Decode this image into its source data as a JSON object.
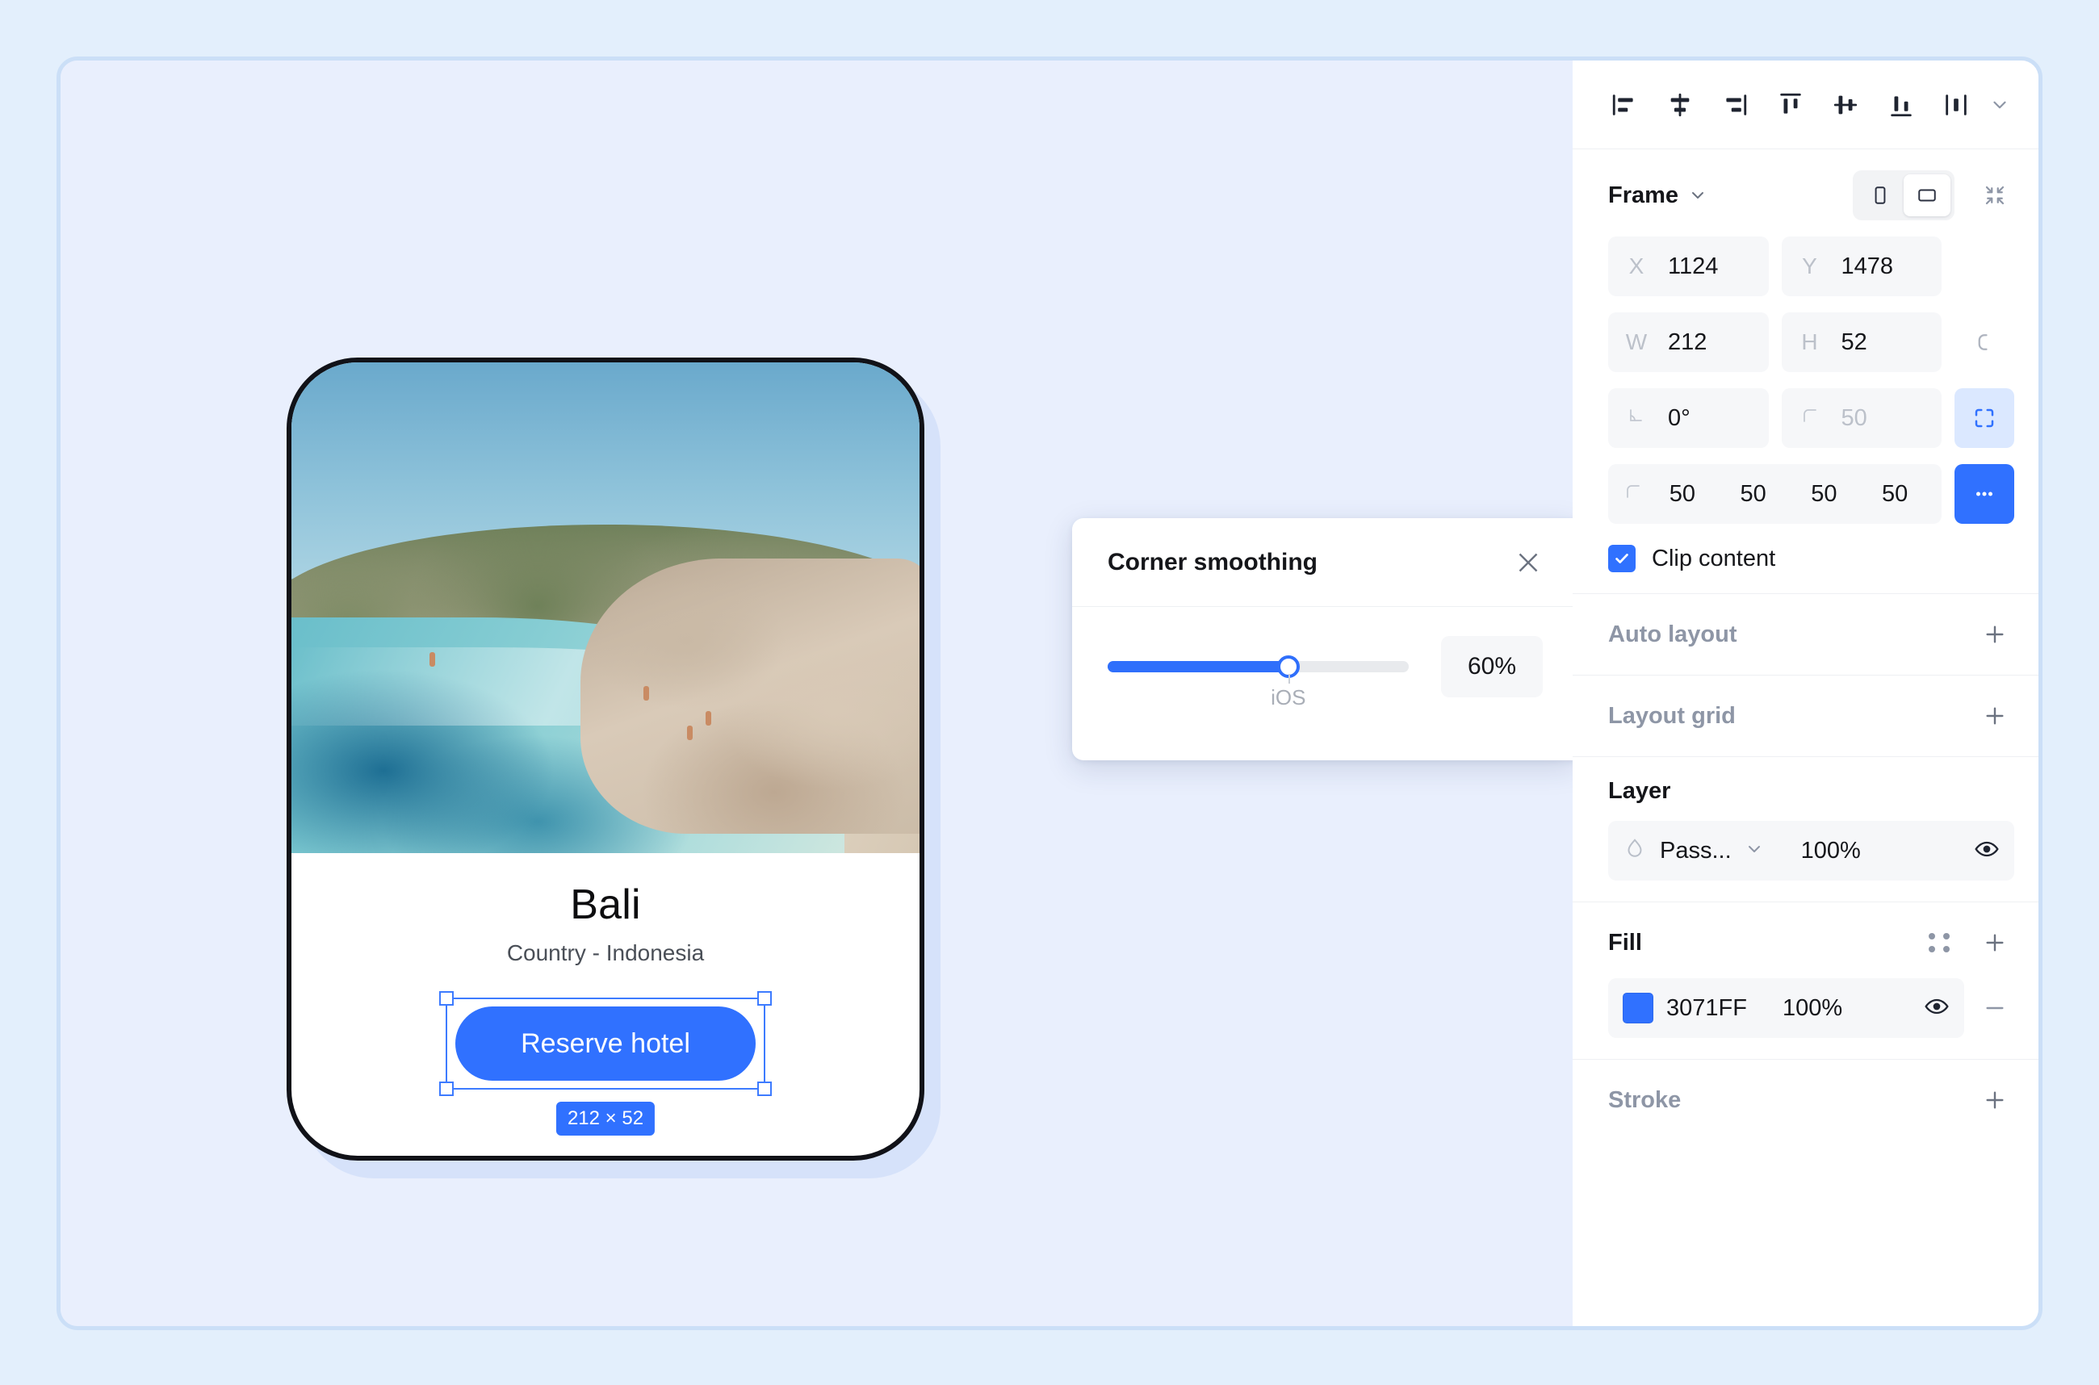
{
  "canvas": {
    "card": {
      "title": "Bali",
      "subtitle": "Country - Indonesia",
      "button_label": "Reserve hotel",
      "size_badge": "212 × 52"
    }
  },
  "dialog": {
    "title": "Corner smoothing",
    "close_icon": "close-icon",
    "slider": {
      "value_percent": 60,
      "tick_label": "iOS",
      "tick_position_percent": 60
    },
    "value_label": "60%"
  },
  "panel": {
    "align_tools": [
      {
        "name": "align-left",
        "label": "Align left"
      },
      {
        "name": "align-horizontal-center",
        "label": "Align horizontal centers"
      },
      {
        "name": "align-right",
        "label": "Align right"
      },
      {
        "name": "align-top",
        "label": "Align top"
      },
      {
        "name": "align-vertical-center",
        "label": "Align vertical centers"
      },
      {
        "name": "align-bottom",
        "label": "Align bottom"
      },
      {
        "name": "distribute",
        "label": "Distribute"
      }
    ],
    "frame": {
      "title": "Frame",
      "orientation_portrait": "portrait",
      "orientation_landscape": "landscape",
      "collapse_icon": "collapse-icon",
      "x_label": "X",
      "x_value": "1124",
      "y_label": "Y",
      "y_value": "1478",
      "w_label": "W",
      "w_value": "212",
      "h_label": "H",
      "h_value": "52",
      "rotation_value": "0°",
      "corner_radius_placeholder": "50",
      "independent_corners_icon": "independent-corners-icon",
      "corner_values": [
        "50",
        "50",
        "50",
        "50"
      ],
      "more_icon": "more-options-icon",
      "clip_content_label": "Clip content",
      "clip_content_checked": true
    },
    "auto_layout": {
      "title": "Auto layout",
      "add_label": "+"
    },
    "layout_grid": {
      "title": "Layout grid",
      "add_label": "+"
    },
    "layer": {
      "title": "Layer",
      "blend_mode": "Pass...",
      "opacity": "100%",
      "visibility_icon": "eye-icon"
    },
    "fill": {
      "title": "Fill",
      "color_hex": "3071FF",
      "color_swatch": "#3071FF",
      "opacity": "100%",
      "visibility_icon": "eye-icon",
      "remove_label": "−"
    },
    "stroke": {
      "title": "Stroke",
      "add_label": "+"
    }
  },
  "colors": {
    "accent": "#3071FF",
    "panel_bg": "#FFFFFF",
    "canvas_bg": "#E9EFFD",
    "page_bg": "#E3EFFC"
  }
}
